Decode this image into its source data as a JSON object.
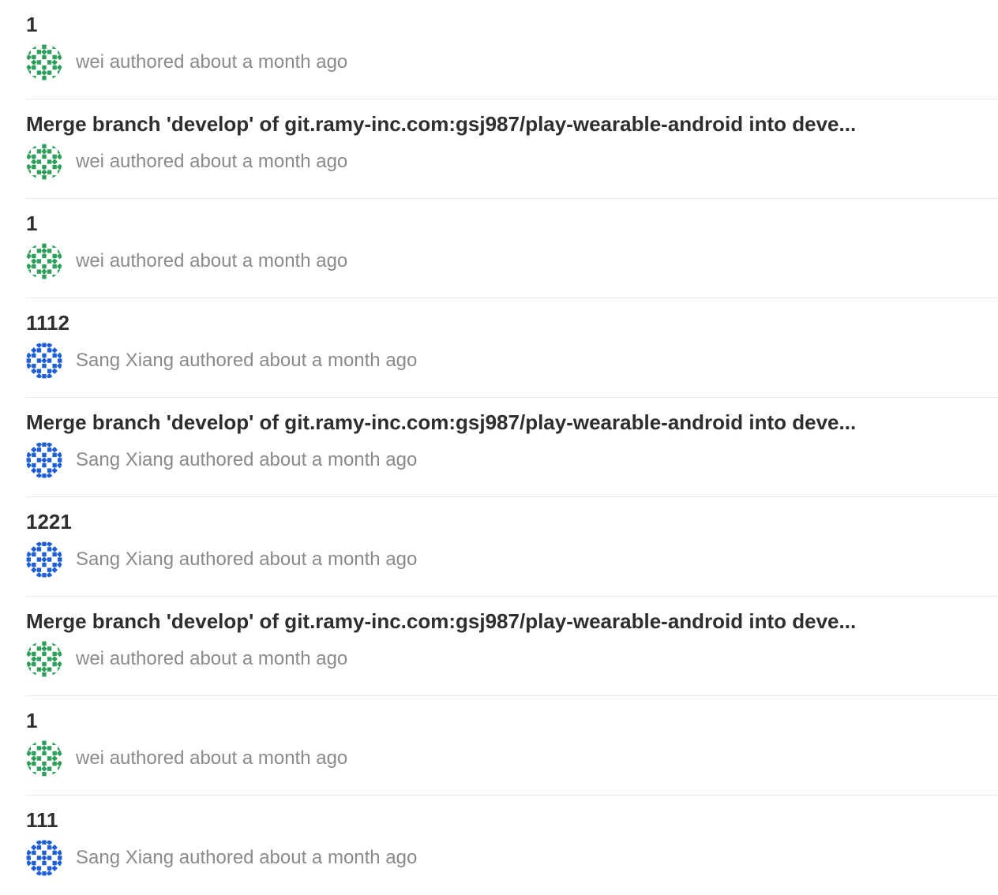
{
  "commits": [
    {
      "title": "1",
      "author": "wei",
      "authored_text": "authored",
      "time": "about a month ago",
      "avatar_color": "#2e9e5b",
      "avatar_icon": "identicon-green"
    },
    {
      "title": "Merge branch 'develop' of git.ramy-inc.com:gsj987/play-wearable-android into deve...",
      "author": "wei",
      "authored_text": "authored",
      "time": "about a month ago",
      "avatar_color": "#2e9e5b",
      "avatar_icon": "identicon-green"
    },
    {
      "title": "1",
      "author": "wei",
      "authored_text": "authored",
      "time": "about a month ago",
      "avatar_color": "#2e9e5b",
      "avatar_icon": "identicon-green"
    },
    {
      "title": "1112",
      "author": "Sang Xiang",
      "authored_text": "authored",
      "time": "about a month ago",
      "avatar_color": "#1f5fd6",
      "avatar_icon": "identicon-blue"
    },
    {
      "title": "Merge branch 'develop' of git.ramy-inc.com:gsj987/play-wearable-android into deve...",
      "author": "Sang Xiang",
      "authored_text": "authored",
      "time": "about a month ago",
      "avatar_color": "#1f5fd6",
      "avatar_icon": "identicon-blue"
    },
    {
      "title": "1221",
      "author": "Sang Xiang",
      "authored_text": "authored",
      "time": "about a month ago",
      "avatar_color": "#1f5fd6",
      "avatar_icon": "identicon-blue"
    },
    {
      "title": "Merge branch 'develop' of git.ramy-inc.com:gsj987/play-wearable-android into deve...",
      "author": "wei",
      "authored_text": "authored",
      "time": "about a month ago",
      "avatar_color": "#2e9e5b",
      "avatar_icon": "identicon-green"
    },
    {
      "title": "1",
      "author": "wei",
      "authored_text": "authored",
      "time": "about a month ago",
      "avatar_color": "#2e9e5b",
      "avatar_icon": "identicon-green"
    },
    {
      "title": "111",
      "author": "Sang Xiang",
      "authored_text": "authored",
      "time": "about a month ago",
      "avatar_color": "#1f5fd6",
      "avatar_icon": "identicon-blue"
    }
  ]
}
